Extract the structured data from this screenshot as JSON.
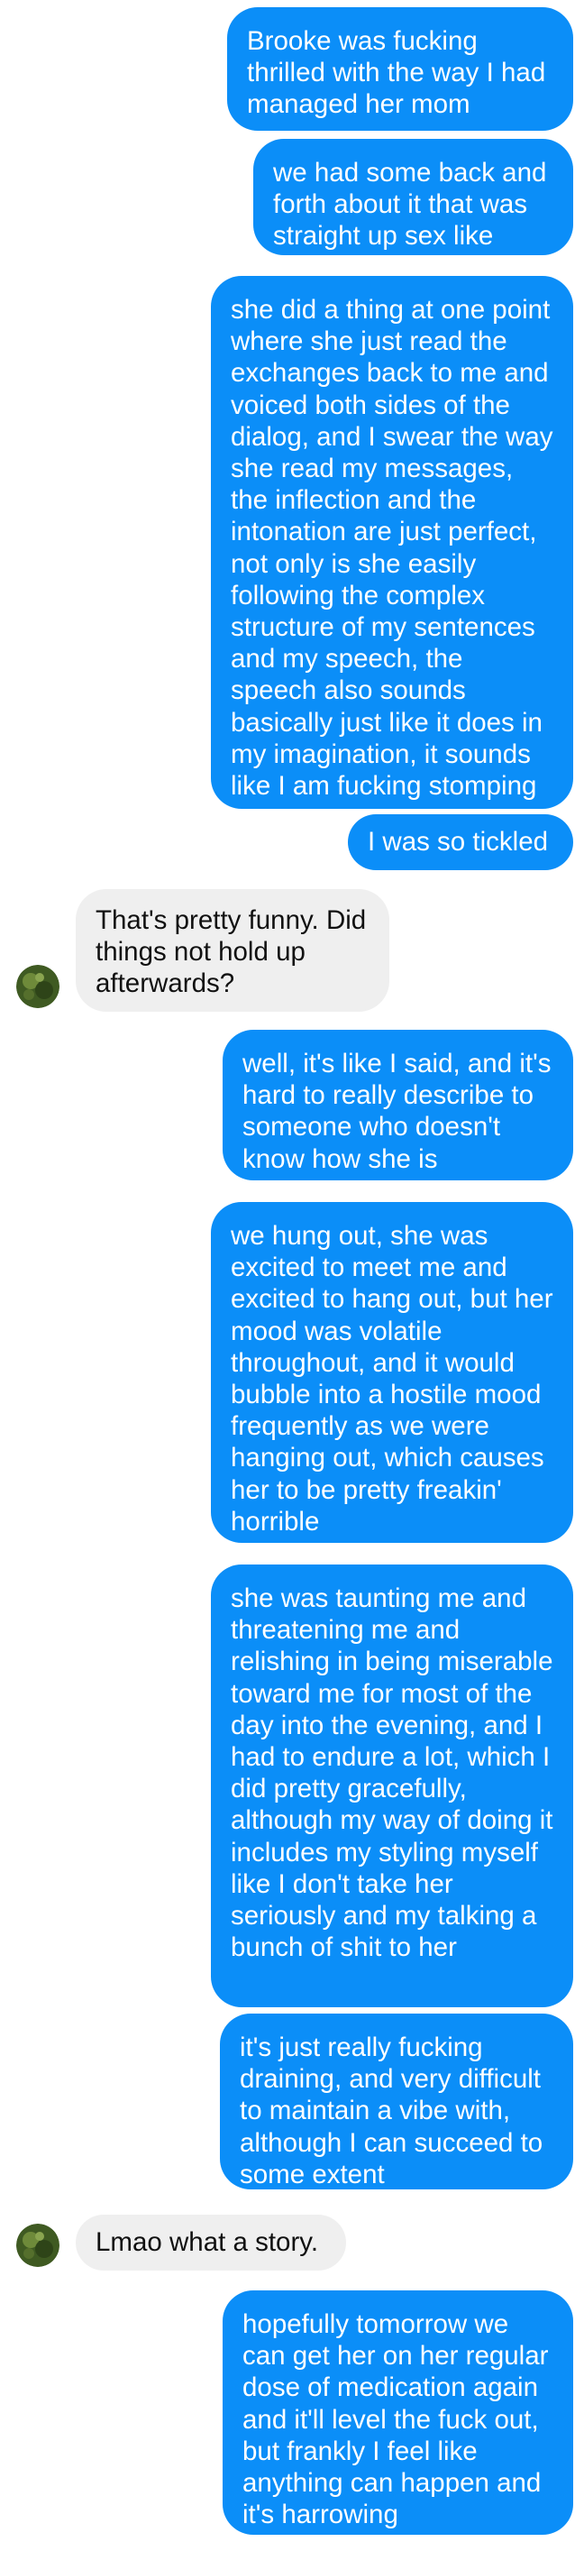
{
  "conversation": {
    "messages": [
      {
        "side": "outgoing",
        "text": "Brooke was fucking thrilled with the way I had managed her mom"
      },
      {
        "side": "outgoing",
        "text": "we had some back and forth about it that was straight up sex like"
      },
      {
        "side": "outgoing",
        "text": "she did a thing at one point where she just read the exchanges back to me and voiced both sides of the dialog, and I swear the way she read my messages, the inflection and the intonation are just perfect, not only is she easily following the complex structure of my sentences and my speech, the speech also sounds basically just like it does in my imagination, it sounds like I am fucking stomping"
      },
      {
        "side": "outgoing",
        "text": "I was so tickled"
      },
      {
        "side": "incoming",
        "text": "That's pretty funny. Did things not hold up afterwards?"
      },
      {
        "side": "outgoing",
        "text": "well, it's like I said, and it's hard to really describe to someone who doesn't know how she is"
      },
      {
        "side": "outgoing",
        "text": "we hung out, she was excited to meet me and excited to hang out, but her mood was volatile throughout, and it would bubble into a hostile mood frequently as we were hanging out, which causes her to be pretty freakin' horrible"
      },
      {
        "side": "outgoing",
        "text": "she was taunting me and threatening me and relishing in being miserable toward me for most of the day into the evening, and I had to endure a lot, which I did pretty gracefully, although my way of doing it includes my styling myself like I don't take her seriously and my talking a bunch of shit to her"
      },
      {
        "side": "outgoing",
        "text": "it's just really fucking draining, and very difficult to maintain a vibe with, although I can succeed to some extent"
      },
      {
        "side": "incoming",
        "text": "Lmao what a story."
      },
      {
        "side": "outgoing",
        "text": "hopefully tomorrow we can get her on her regular dose of medication again and it'll level the fuck out, but frankly I feel like anything can happen and it's harrowing"
      }
    ]
  },
  "colors": {
    "outgoing_bubble": "#0b8ef8",
    "outgoing_text": "#ffffff",
    "incoming_bubble": "#efefef",
    "incoming_text": "#111111"
  },
  "icons": {
    "contact_avatar": "avatar-icon"
  }
}
